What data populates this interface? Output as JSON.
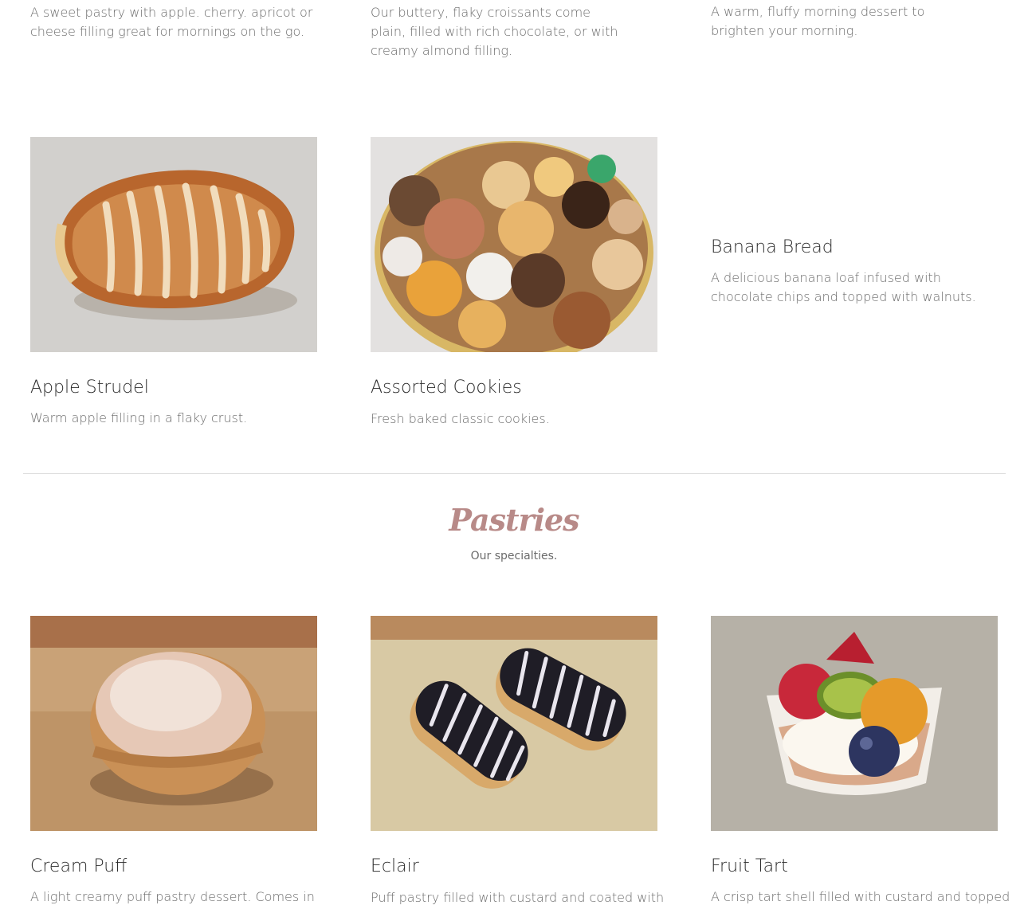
{
  "top_row": [
    {
      "description": "A sweet pastry with apple. cherry. apricot or cheese filling great for mornings on the go."
    },
    {
      "description": "Our buttery, flaky croissants come plain, filled with rich chocolate, or with creamy almond filling."
    },
    {
      "description": "A warm, fluffy morning dessert to brighten your morning."
    }
  ],
  "middle_row": [
    {
      "title": "Apple Strudel",
      "description": "Warm apple filling in a flaky crust.",
      "image_icon": "apple-strudel-photo"
    },
    {
      "title": "Assorted Cookies",
      "description": "Fresh baked classic cookies.",
      "image_icon": "assorted-cookies-photo"
    },
    {
      "title": "Banana Bread",
      "description": "A delicious banana loaf infused with chocolate chips and topped with walnuts."
    }
  ],
  "section": {
    "title": "Pastries",
    "subtitle": "Our specialties."
  },
  "bottom_row": [
    {
      "title": "Cream Puff",
      "description": "A light creamy puff pastry dessert. Comes in",
      "image_icon": "cream-puff-photo"
    },
    {
      "title": "Eclair",
      "description": "Puff pastry filled with custard and coated with",
      "image_icon": "eclair-photo"
    },
    {
      "title": "Fruit Tart",
      "description": "A crisp tart shell filled with custard and topped",
      "image_icon": "fruit-tart-photo"
    }
  ],
  "colors": {
    "accent": "#b88a88",
    "text": "#2c2c2c",
    "muted": "#6b6b6b",
    "divider": "#dddddd"
  }
}
